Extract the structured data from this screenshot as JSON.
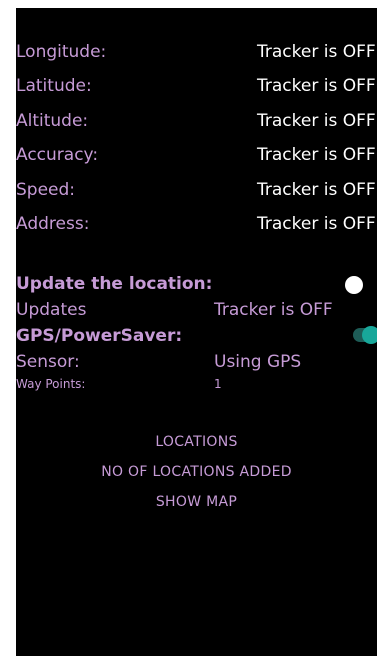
{
  "info_rows": [
    {
      "label": "Longitude:",
      "value": "Tracker is OFF"
    },
    {
      "label": "Latitude:",
      "value": "Tracker is OFF"
    },
    {
      "label": "Altitude:",
      "value": "Tracker is OFF"
    },
    {
      "label": "Accuracy:",
      "value": "Tracker is OFF"
    },
    {
      "label": "Speed:",
      "value": "Tracker is OFF"
    },
    {
      "label": "Address:",
      "value": "Tracker is OFF"
    }
  ],
  "update_location": {
    "label": "Update the location:",
    "switch_on": false
  },
  "updates": {
    "label": "Updates",
    "value": "Tracker is OFF"
  },
  "gps_power": {
    "label": "GPS/PowerSaver:",
    "switch_on": true
  },
  "sensor": {
    "label": "Sensor:",
    "value": "Using GPS"
  },
  "waypoints": {
    "label": "Way Points:",
    "value": "1"
  },
  "buttons": {
    "locations": "LOCATIONS",
    "no_of_locations": "NO OF LOCATIONS ADDED",
    "show_map": "SHOW MAP"
  },
  "colors": {
    "label": "#c69bd6",
    "value": "#ffffff",
    "background": "#000000",
    "switch_active": "#18a79a"
  }
}
